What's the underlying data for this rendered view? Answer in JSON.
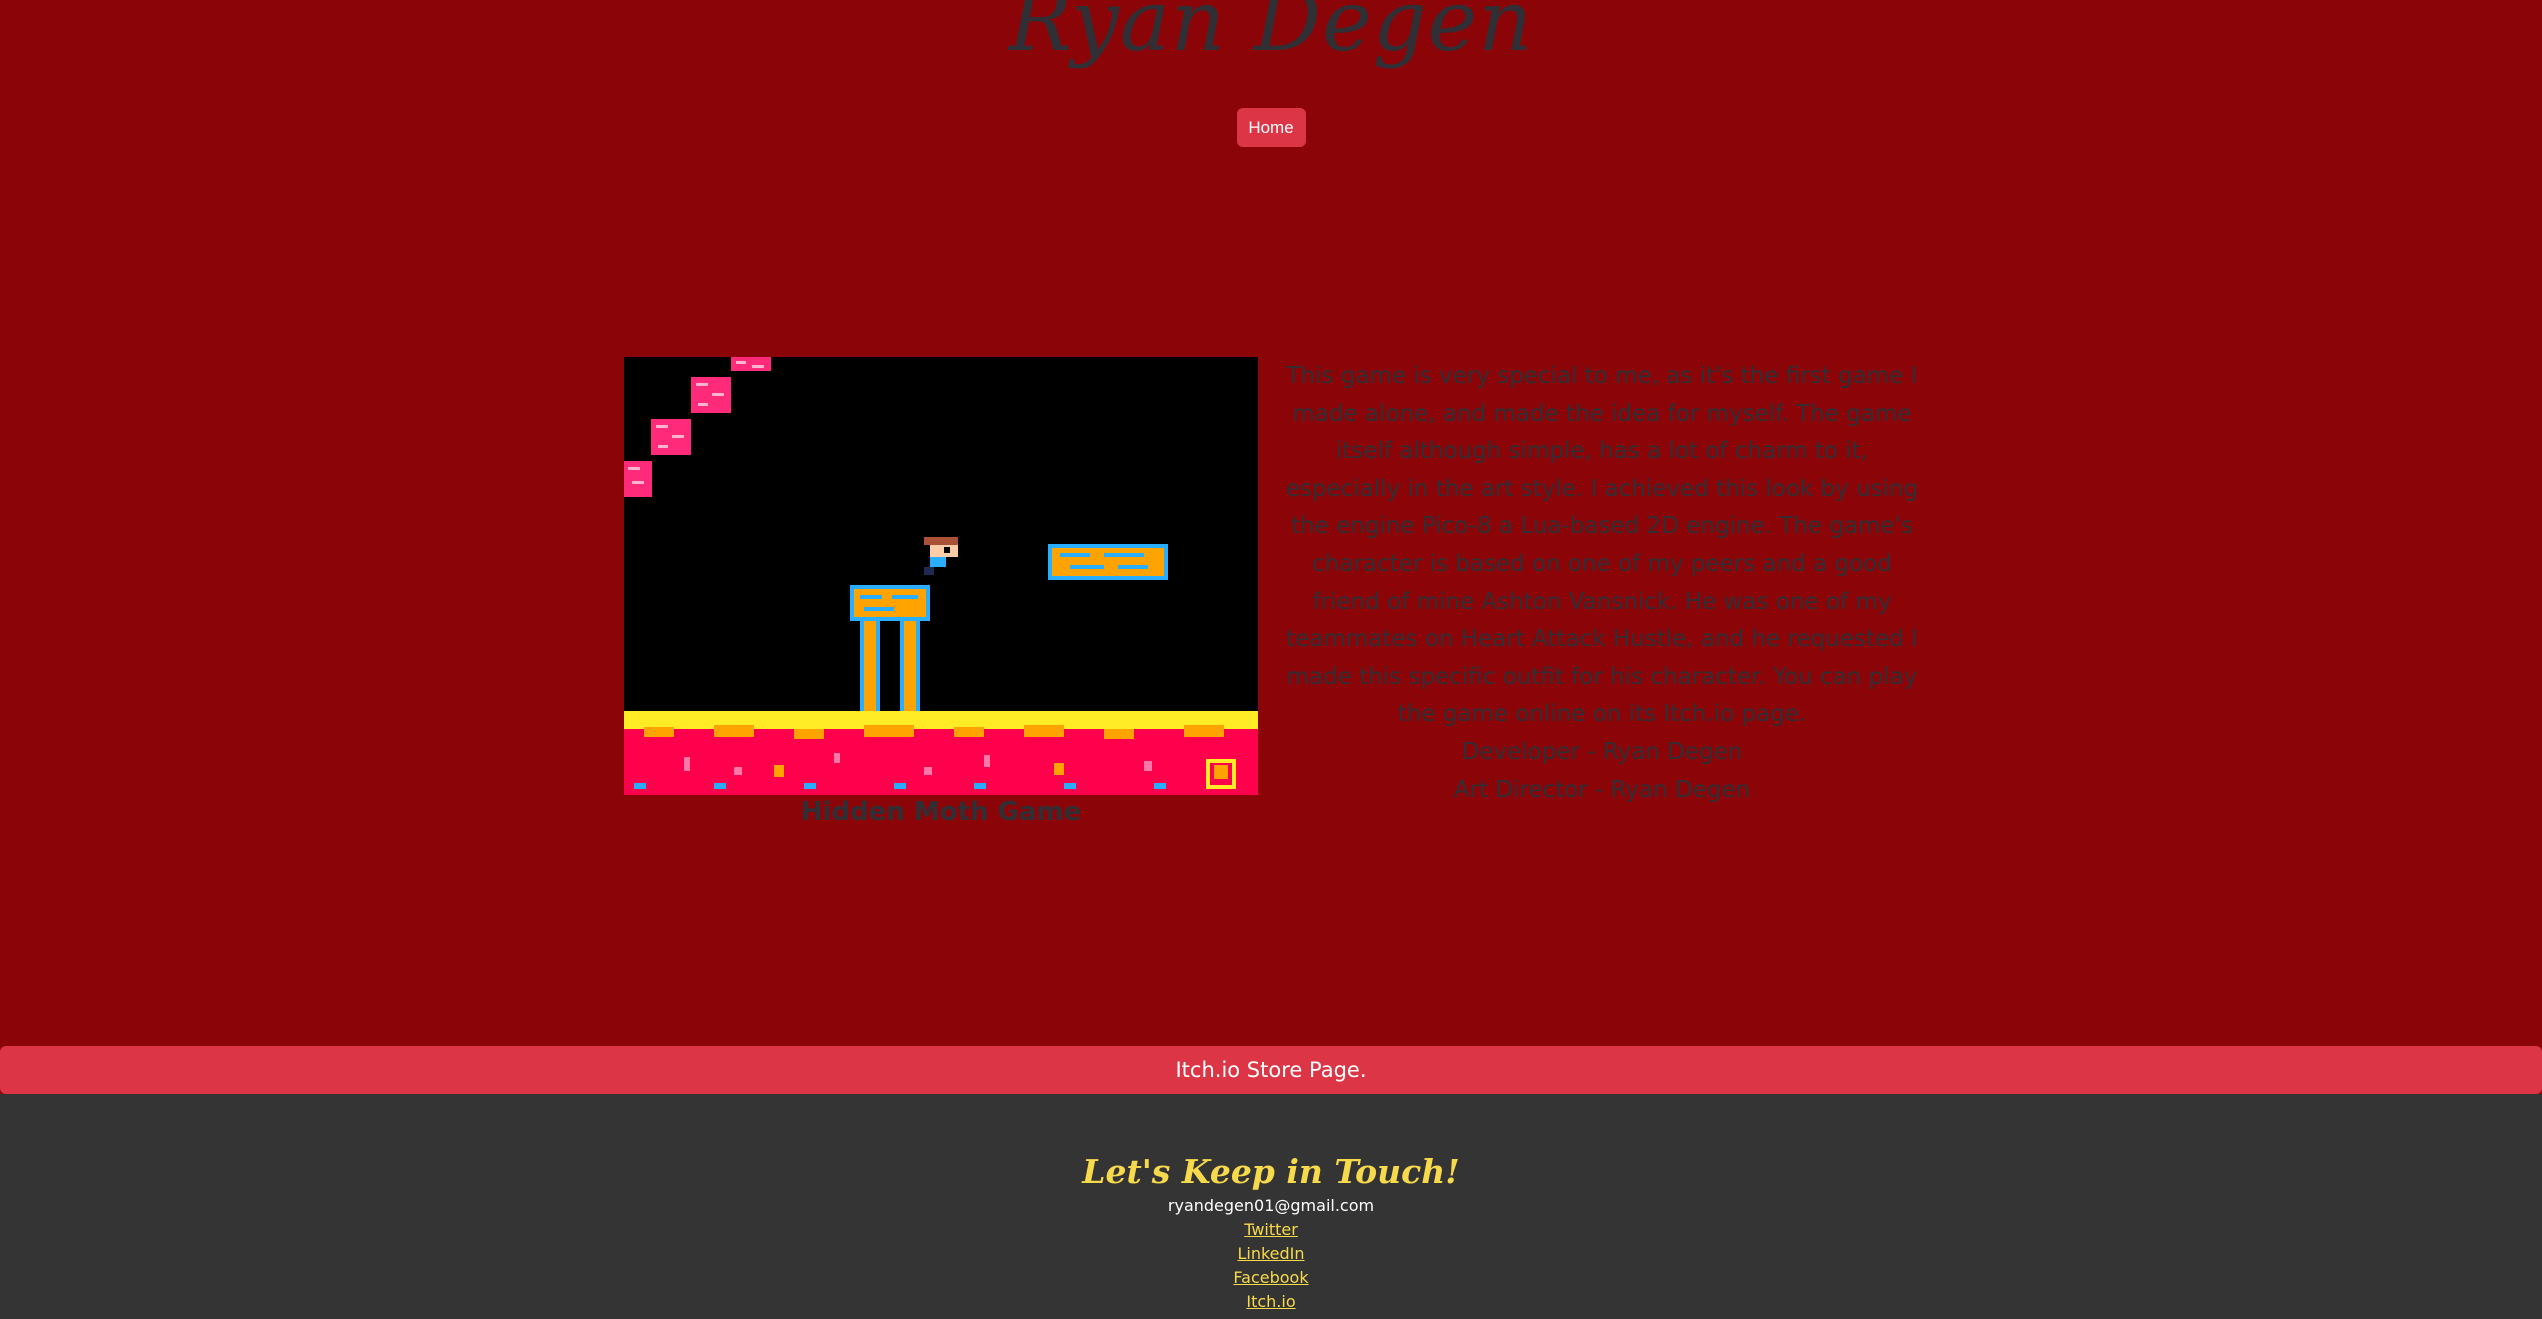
{
  "header": {
    "title": "Ryan Degen"
  },
  "nav": {
    "home_label": "Home"
  },
  "project": {
    "caption": "Hidden Moth Game",
    "description": "This game is very special to me, as it's the first game I made alone, and made the idea for myself. The game itself although simple, has a lot of charm to it, especially in the art style. I achieved this look by using the engine Pico-8 a Lua-based 2D engine. The game's character is based on one of my peers and a good friend of mine Ashton Vansnick. He was one of my teammates on Heart Attack Hustle, and he requested I made this specific outfit for his character. You can play the game online on its Itch.io page.",
    "credits": [
      "Developer - Ryan Degen",
      "Art Director - Ryan Degen"
    ]
  },
  "store_button": {
    "label": "Itch.io Store Page."
  },
  "footer": {
    "title": "Let's Keep in Touch!",
    "email": "ryandegen01@gmail.com",
    "links": [
      "Twitter",
      "LinkedIn",
      "Facebook",
      "Itch.io"
    ]
  },
  "colors": {
    "page_bg": "#8b0508",
    "accent_button": "#dc3545",
    "footer_bg": "#343434",
    "footer_accent": "#f7d94c",
    "text_dark": "#2f2f35"
  }
}
